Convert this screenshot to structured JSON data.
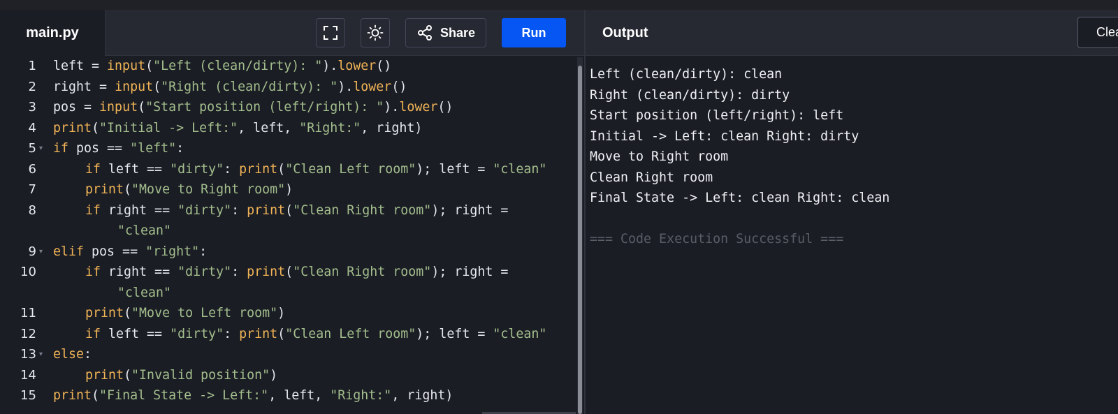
{
  "editor": {
    "file_tab": "main.py",
    "share_label": "Share",
    "run_label": "Run",
    "lines": [
      {
        "n": "1",
        "fold": false,
        "segs": [
          [
            "",
            "left = "
          ],
          [
            "fn",
            "input"
          ],
          [
            "",
            "("
          ],
          [
            "str",
            "\"Left (clean/dirty): \""
          ],
          [
            "",
            ")."
          ],
          [
            "fn",
            "lower"
          ],
          [
            "",
            "()"
          ]
        ]
      },
      {
        "n": "2",
        "fold": false,
        "segs": [
          [
            "",
            "right = "
          ],
          [
            "fn",
            "input"
          ],
          [
            "",
            "("
          ],
          [
            "str",
            "\"Right (clean/dirty): \""
          ],
          [
            "",
            ")."
          ],
          [
            "fn",
            "lower"
          ],
          [
            "",
            "()"
          ]
        ]
      },
      {
        "n": "3",
        "fold": false,
        "segs": [
          [
            "",
            "pos = "
          ],
          [
            "fn",
            "input"
          ],
          [
            "",
            "("
          ],
          [
            "str",
            "\"Start position (left/right): \""
          ],
          [
            "",
            ")."
          ],
          [
            "fn",
            "lower"
          ],
          [
            "",
            "()"
          ]
        ]
      },
      {
        "n": "4",
        "fold": false,
        "segs": [
          [
            "fn",
            "print"
          ],
          [
            "",
            "("
          ],
          [
            "str",
            "\"Initial -> Left:\""
          ],
          [
            "",
            ", left, "
          ],
          [
            "str",
            "\"Right:\""
          ],
          [
            "",
            ", right)"
          ]
        ]
      },
      {
        "n": "5",
        "fold": true,
        "segs": [
          [
            "kw",
            "if"
          ],
          [
            "",
            " pos == "
          ],
          [
            "str",
            "\"left\""
          ],
          [
            "",
            ":"
          ]
        ]
      },
      {
        "n": "6",
        "fold": false,
        "indent": 1,
        "segs": [
          [
            "kw",
            "if"
          ],
          [
            "",
            " left == "
          ],
          [
            "str",
            "\"dirty\""
          ],
          [
            "",
            ": "
          ],
          [
            "fn",
            "print"
          ],
          [
            "",
            "("
          ],
          [
            "str",
            "\"Clean Left room\""
          ],
          [
            "",
            "); left = "
          ],
          [
            "str",
            "\"clean\""
          ]
        ]
      },
      {
        "n": "7",
        "fold": false,
        "indent": 1,
        "segs": [
          [
            "fn",
            "print"
          ],
          [
            "",
            "("
          ],
          [
            "str",
            "\"Move to Right room\""
          ],
          [
            "",
            ")"
          ]
        ]
      },
      {
        "n": "8",
        "fold": false,
        "indent": 1,
        "segs": [
          [
            "kw",
            "if"
          ],
          [
            "",
            " right == "
          ],
          [
            "str",
            "\"dirty\""
          ],
          [
            "",
            ": "
          ],
          [
            "fn",
            "print"
          ],
          [
            "",
            "("
          ],
          [
            "str",
            "\"Clean Right room\""
          ],
          [
            "",
            "); right ="
          ]
        ]
      },
      {
        "n": "",
        "fold": false,
        "indent": 2,
        "segs": [
          [
            "str",
            "\"clean\""
          ]
        ]
      },
      {
        "n": "9",
        "fold": true,
        "segs": [
          [
            "kw",
            "elif"
          ],
          [
            "",
            " pos == "
          ],
          [
            "str",
            "\"right\""
          ],
          [
            "",
            ":"
          ]
        ]
      },
      {
        "n": "10",
        "fold": false,
        "indent": 1,
        "segs": [
          [
            "kw",
            "if"
          ],
          [
            "",
            " right == "
          ],
          [
            "str",
            "\"dirty\""
          ],
          [
            "",
            ": "
          ],
          [
            "fn",
            "print"
          ],
          [
            "",
            "("
          ],
          [
            "str",
            "\"Clean Right room\""
          ],
          [
            "",
            "); right ="
          ]
        ]
      },
      {
        "n": "",
        "fold": false,
        "indent": 2,
        "segs": [
          [
            "str",
            "\"clean\""
          ]
        ]
      },
      {
        "n": "11",
        "fold": false,
        "indent": 1,
        "segs": [
          [
            "fn",
            "print"
          ],
          [
            "",
            "("
          ],
          [
            "str",
            "\"Move to Left room\""
          ],
          [
            "",
            ")"
          ]
        ]
      },
      {
        "n": "12",
        "fold": false,
        "indent": 1,
        "segs": [
          [
            "kw",
            "if"
          ],
          [
            "",
            " left == "
          ],
          [
            "str",
            "\"dirty\""
          ],
          [
            "",
            ": "
          ],
          [
            "fn",
            "print"
          ],
          [
            "",
            "("
          ],
          [
            "str",
            "\"Clean Left room\""
          ],
          [
            "",
            "); left = "
          ],
          [
            "str",
            "\"clean\""
          ]
        ]
      },
      {
        "n": "13",
        "fold": true,
        "segs": [
          [
            "kw",
            "else"
          ],
          [
            "",
            ":"
          ]
        ]
      },
      {
        "n": "14",
        "fold": false,
        "indent": 1,
        "segs": [
          [
            "fn",
            "print"
          ],
          [
            "",
            "("
          ],
          [
            "str",
            "\"Invalid position\""
          ],
          [
            "",
            ")"
          ]
        ]
      },
      {
        "n": "15",
        "fold": false,
        "segs": [
          [
            "fn",
            "print"
          ],
          [
            "",
            "("
          ],
          [
            "str",
            "\"Final State -> Left:\""
          ],
          [
            "",
            ", left, "
          ],
          [
            "str",
            "\"Right:\""
          ],
          [
            "",
            ", right)"
          ]
        ]
      }
    ]
  },
  "output": {
    "title": "Output",
    "clear_label": "Clear",
    "lines": [
      "Left (clean/dirty): clean",
      "Right (clean/dirty): dirty",
      "Start position (left/right): left",
      "Initial -> Left: clean Right: dirty",
      "Move to Right room",
      "Clean Right room",
      "Final State -> Left: clean Right: clean",
      "",
      "=== Code Execution Successful ==="
    ]
  },
  "colors": {
    "run_button": "#0556f3",
    "keyword": "#f0b456",
    "string": "#a3be8c",
    "background": "#1b1d25"
  }
}
